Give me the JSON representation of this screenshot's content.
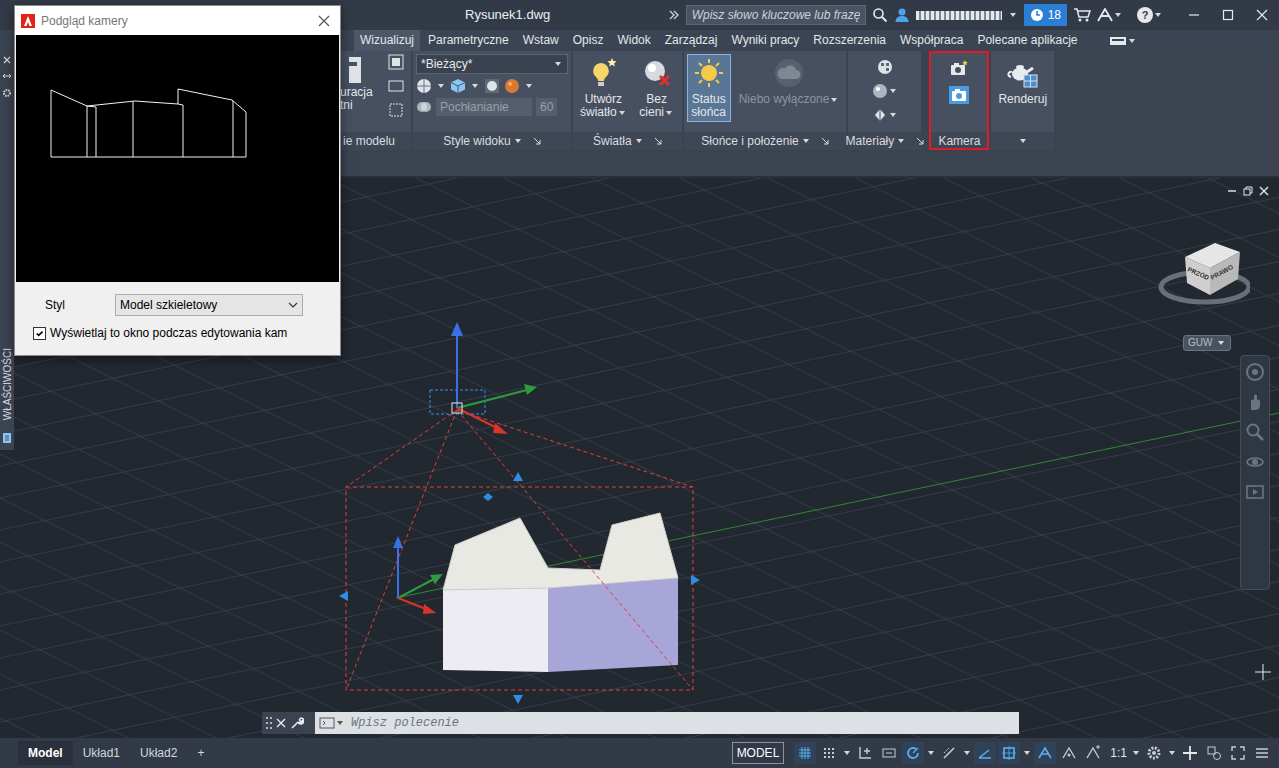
{
  "window": {
    "title": "Rysunek1.dwg"
  },
  "title_bar": {
    "search_placeholder": "Wpisz słowo kluczowe lub frazę",
    "notification_count": "18",
    "help": "?"
  },
  "ribbon_tabs": [
    {
      "label": "Wizualizuj",
      "selected": true
    },
    {
      "label": "Parametryczne",
      "selected": false
    },
    {
      "label": "Wstaw",
      "selected": false
    },
    {
      "label": "Opisz",
      "selected": false
    },
    {
      "label": "Widok",
      "selected": false
    },
    {
      "label": "Zarządzaj",
      "selected": false
    },
    {
      "label": "Wyniki pracy",
      "selected": false
    },
    {
      "label": "Rozszerzenia",
      "selected": false
    },
    {
      "label": "Współpraca",
      "selected": false
    },
    {
      "label": "Polecane aplikacje",
      "selected": false
    }
  ],
  "ribbon_panels": [
    {
      "kind": "partial",
      "label": "ie modelu",
      "label_dropdown": false,
      "launcher": false,
      "highlighted": false,
      "lines": [
        "uracja",
        "tni"
      ]
    },
    {
      "kind": "styles",
      "label": "Style widoku",
      "label_dropdown": true,
      "launcher": true,
      "highlighted": false,
      "visual_style": "*Bieżący*",
      "opacity_label": "Pochłanianie",
      "opacity_value": "60",
      "opacity_disabled": true
    },
    {
      "kind": "buttons",
      "label": "Światła",
      "label_dropdown": true,
      "launcher": true,
      "highlighted": false,
      "buttons": [
        {
          "kind": "create-light",
          "lines": [
            "Utwórz",
            "światło"
          ],
          "dropdown": true,
          "active": false,
          "disabled": false
        },
        {
          "kind": "shadows",
          "lines": [
            "Bez",
            "cieni"
          ],
          "dropdown": true,
          "active": false,
          "disabled": false
        }
      ]
    },
    {
      "kind": "buttons",
      "label": "Słońce i położenie",
      "label_dropdown": true,
      "launcher": true,
      "highlighted": false,
      "buttons": [
        {
          "kind": "sun-status",
          "lines": [
            "Status",
            "słońca"
          ],
          "dropdown": false,
          "active": true,
          "disabled": false
        },
        {
          "kind": "sky",
          "lines": [
            "Niebo wyłączone"
          ],
          "dropdown": true,
          "active": false,
          "disabled": true
        }
      ]
    },
    {
      "kind": "materials",
      "label": "Materiały",
      "label_dropdown": true,
      "launcher": true,
      "highlighted": false
    },
    {
      "kind": "camera",
      "label": "Kamera",
      "label_dropdown": false,
      "launcher": false,
      "highlighted": true
    },
    {
      "kind": "buttons",
      "label_dropdown": true,
      "launcher": false,
      "highlighted": false,
      "buttons": [
        {
          "kind": "render",
          "lines": [
            "Renderuj"
          ],
          "dropdown": false,
          "active": false,
          "disabled": false
        }
      ]
    }
  ],
  "camera_preview": {
    "title": "Podgląd kamery",
    "style_label": "Styl",
    "style_value": "Model szkieletowy",
    "show_while_editing": {
      "label": "Wyświetlaj to okno podczas edytowania kam",
      "checked": true
    }
  },
  "palette": {
    "label": "WŁAŚCIWOŚCI"
  },
  "viewcube": {
    "left_face": "PRZÓD",
    "right_face": "PRAWO",
    "ucs": "GUW"
  },
  "command_line": {
    "placeholder": "Wpisz polecenie"
  },
  "layout_tabs": [
    {
      "label": "Model",
      "selected": true
    },
    {
      "label": "Układ1",
      "selected": false
    },
    {
      "label": "Układ2",
      "selected": false
    }
  ],
  "add_layout": "+",
  "status_bar": {
    "space": "MODEL",
    "scale": "1:1",
    "toggles": [
      {
        "on": true,
        "dropdown": false
      },
      {
        "on": false,
        "dropdown": true
      },
      {
        "on": false,
        "dropdown": false
      },
      {
        "on": false,
        "dropdown": false
      },
      {
        "on": true,
        "dropdown": true
      },
      {
        "on": false,
        "dropdown": true
      },
      {
        "on": true,
        "dropdown": false
      },
      {
        "on": true,
        "dropdown": true
      },
      {
        "on": true,
        "dropdown": false
      },
      {
        "on": false,
        "dropdown": false
      },
      {
        "on": false,
        "dropdown": false
      }
    ]
  }
}
